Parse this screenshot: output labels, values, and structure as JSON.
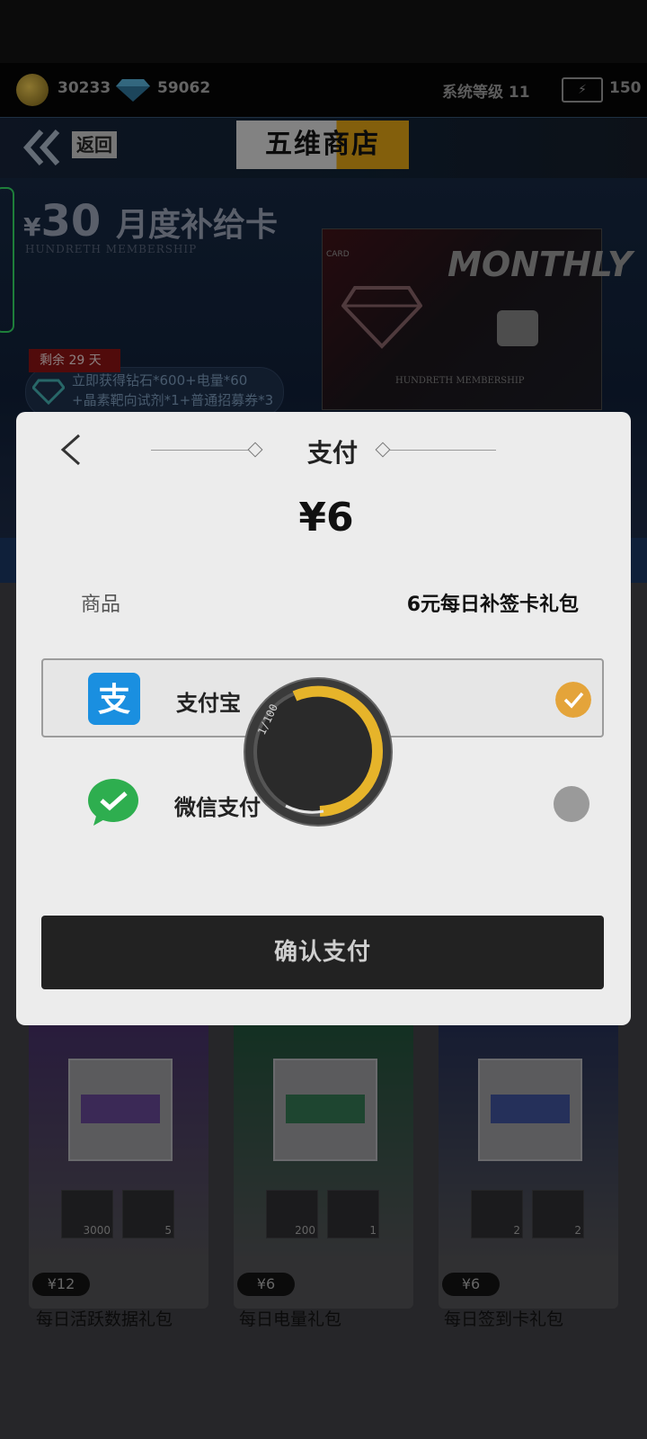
{
  "resources": {
    "coins": "30233",
    "diamonds": "59062",
    "level": "系统等级 11",
    "energy": "150"
  },
  "header": {
    "back_label": "返回",
    "title": "五维商店"
  },
  "banner": {
    "price_symbol": "¥",
    "price_value": "30",
    "title": "月度补给卡",
    "subtitle": "HUNDRETH MEMBERSHIP",
    "card_label": "CARD",
    "card_monthly": "MONTHLY",
    "card_member": "HUNDRETH MEMBERSHIP",
    "remaining": "剩余 29 天",
    "reward_line1": "立即获得钻石*600+电量*60",
    "reward_line2": "+晶素靶向试剂*1+普通招募券*3"
  },
  "packages": [
    {
      "price": "¥12",
      "name": "每日活跃数据礼包",
      "slots": [
        "3000",
        "5"
      ],
      "color": "#4a2a6e"
    },
    {
      "price": "¥6",
      "name": "每日电量礼包",
      "slots": [
        "200",
        "1"
      ],
      "color": "#1e5a3a"
    },
    {
      "price": "¥6",
      "name": "每日签到卡礼包",
      "slots": [
        "2",
        "2"
      ],
      "color": "#26315a"
    }
  ],
  "payment": {
    "title": "支付",
    "amount": "¥6",
    "goods_label": "商品",
    "goods_value": "6元每日补签卡礼包",
    "methods": [
      {
        "label": "支付宝",
        "selected": true
      },
      {
        "label": "微信支付",
        "selected": false
      }
    ],
    "confirm_label": "确认支付",
    "loader_text": "1/100"
  },
  "colors": {
    "accent": "#e4a43a",
    "wechat": "#2eae4f",
    "alipay": "#1a8fe0"
  }
}
